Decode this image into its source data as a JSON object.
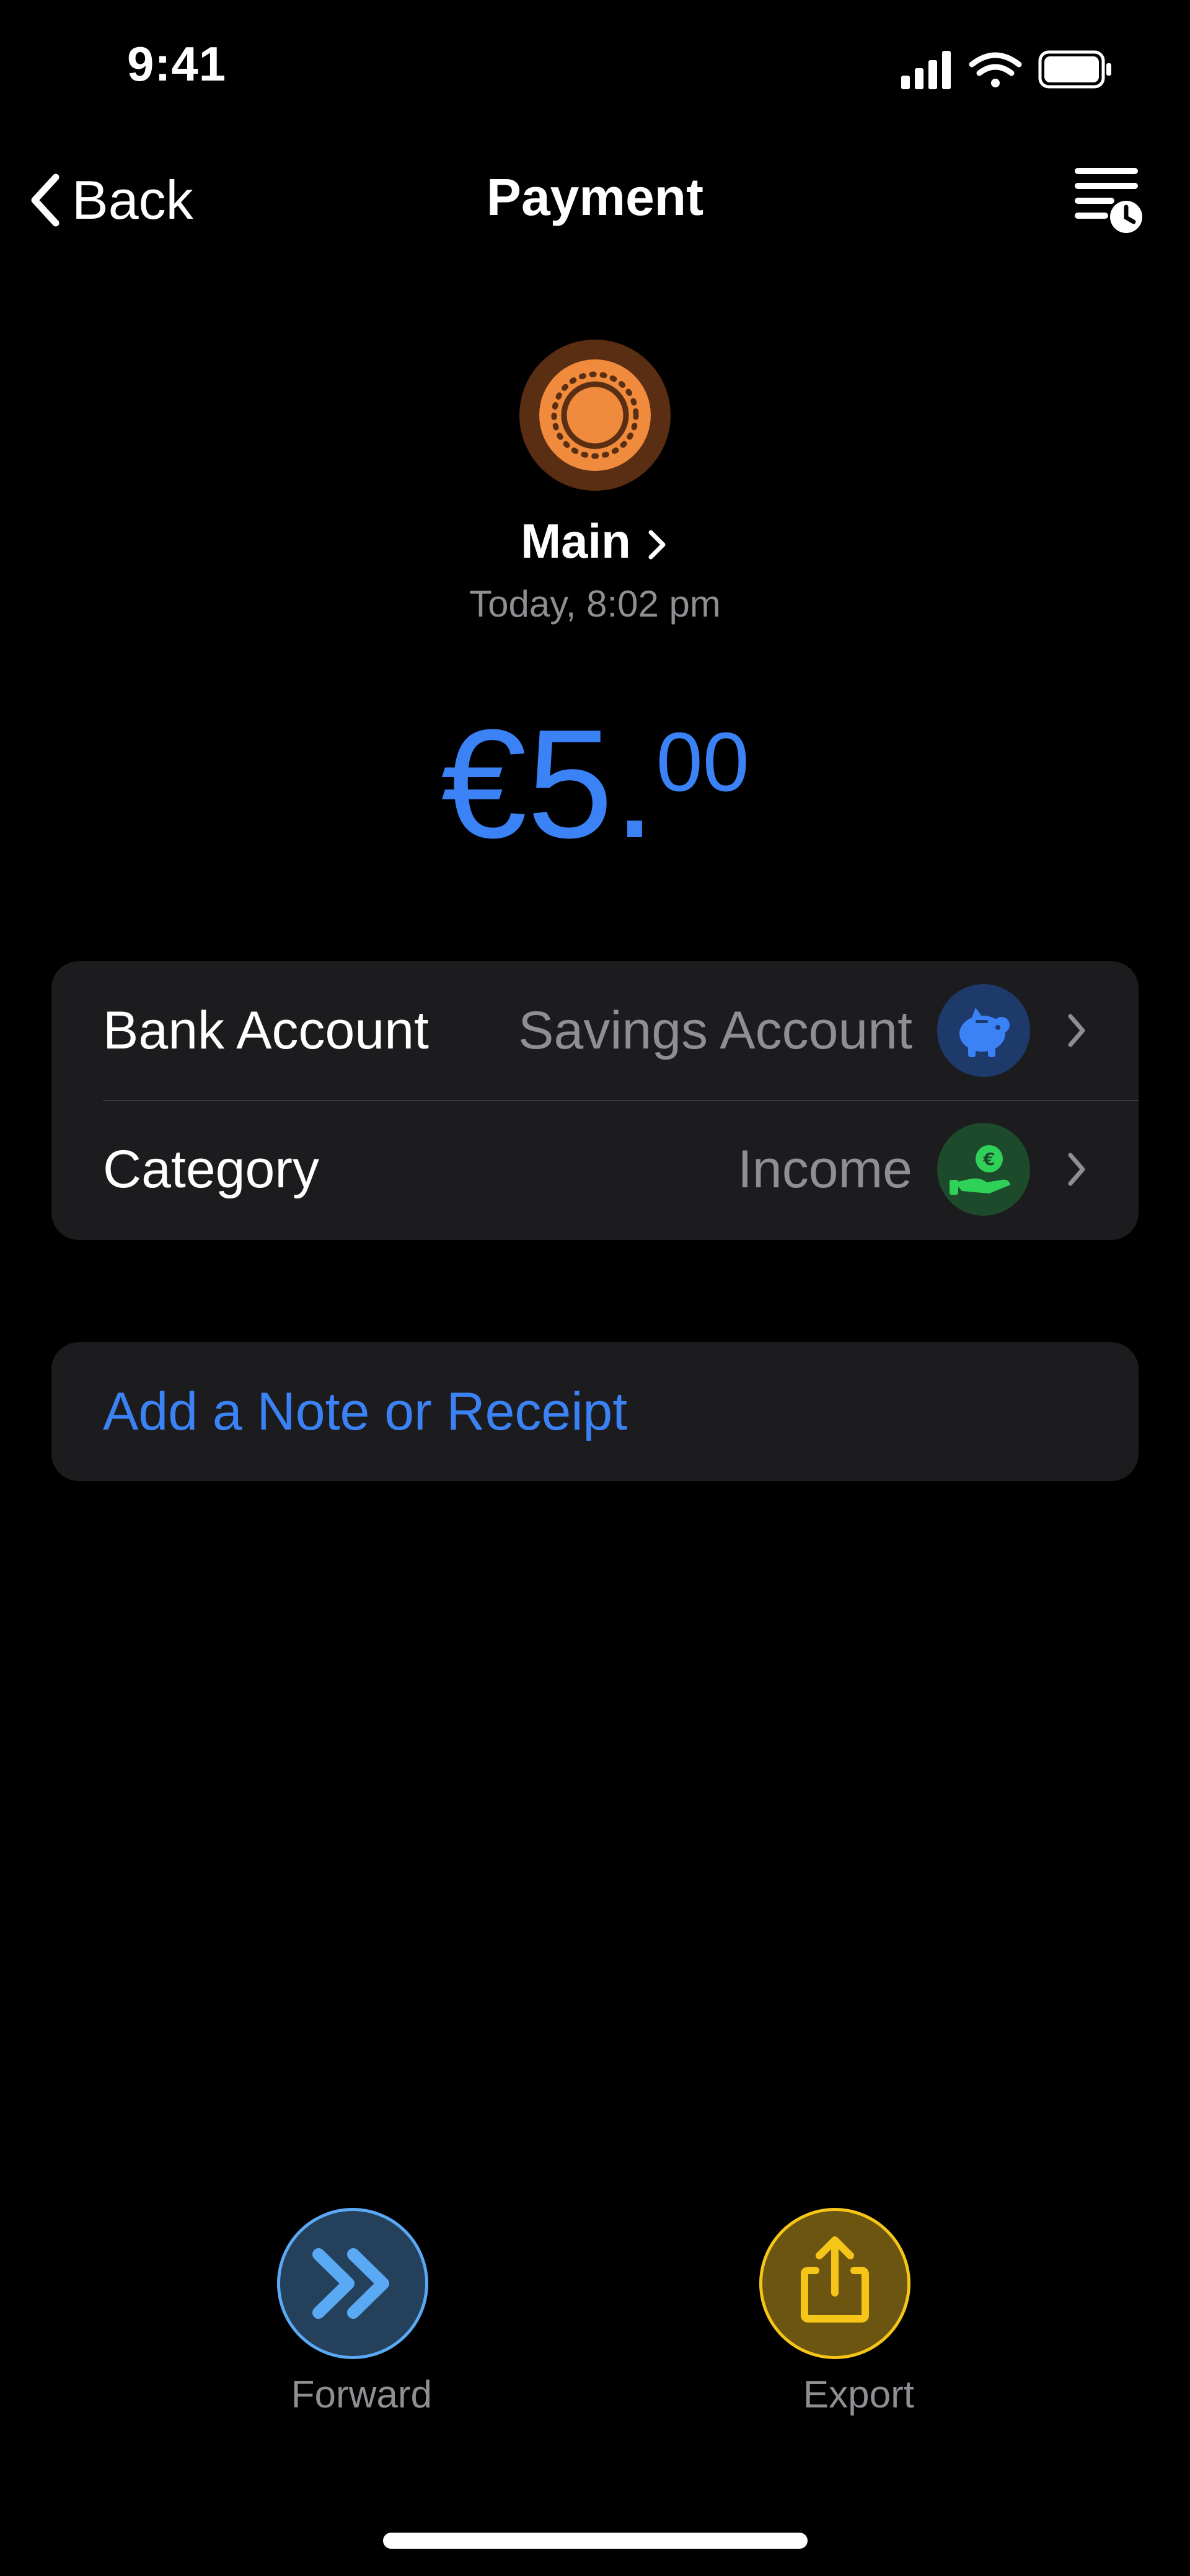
{
  "status_bar": {
    "time": "9:41"
  },
  "nav": {
    "back_label": "Back",
    "title": "Payment"
  },
  "header": {
    "account_name": "Main",
    "date": "Today, 8:02 pm"
  },
  "amount": {
    "currency": "€",
    "whole": "5",
    "separator": ".",
    "cents": "00"
  },
  "details": [
    {
      "label": "Bank Account",
      "value": "Savings Account",
      "icon": "piggy-bank-icon",
      "icon_color": "#3b82f6",
      "icon_bg": "#1e3a6b"
    },
    {
      "label": "Category",
      "value": "Income",
      "icon": "hand-euro-icon",
      "icon_color": "#30d158",
      "icon_bg": "#1d4a2a"
    }
  ],
  "note": {
    "label": "Add a Note or Receipt"
  },
  "actions": [
    {
      "label": "Forward",
      "icon": "forward-icon",
      "color": "#5aa9f5",
      "bg": "#25405a"
    },
    {
      "label": "Export",
      "icon": "share-icon",
      "color": "#f5c518",
      "bg": "#6b5510"
    }
  ],
  "colors": {
    "accent": "#3b82f6",
    "avatar": "#f08a3c",
    "background": "#000000",
    "card": "#1c1c1e"
  }
}
